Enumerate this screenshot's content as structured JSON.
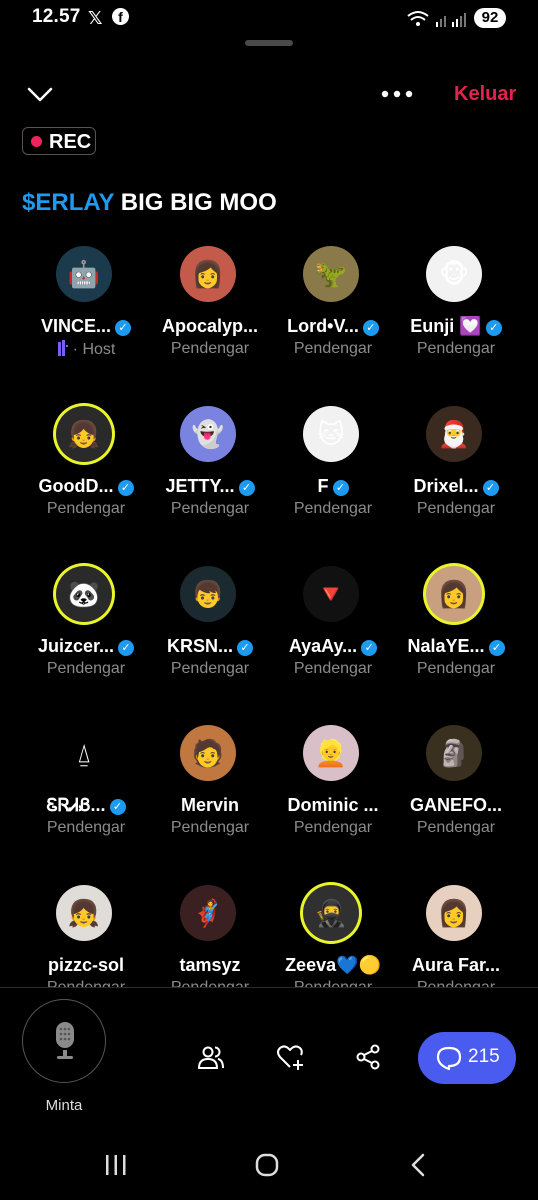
{
  "status_bar": {
    "time": "12.57",
    "battery": "92"
  },
  "header": {
    "leave_label": "Keluar",
    "rec_label": "REC"
  },
  "space": {
    "title_highlight": "$ERLAY",
    "title_rest": " BIG BIG MOO"
  },
  "participants": [
    {
      "name": "VINCE...",
      "verified": true,
      "role": "Host",
      "avatar_bg": "#1b3a4b",
      "glyph": "🤖"
    },
    {
      "name": "Apocalyp...",
      "verified": false,
      "role": "Pendengar",
      "avatar_bg": "#c45a4a",
      "glyph": "👩"
    },
    {
      "name": "Lord•V...",
      "verified": true,
      "role": "Pendengar",
      "avatar_bg": "#8a7a4a",
      "glyph": "🦖"
    },
    {
      "name": "Eunji 💟",
      "verified": true,
      "role": "Pendengar",
      "avatar_bg": "#f2f2f2",
      "glyph": "🐵"
    },
    {
      "name": "GoodD...",
      "verified": true,
      "role": "Pendengar",
      "avatar_bg": "#2a2a2a",
      "glyph": "👧",
      "ring": true
    },
    {
      "name": "JETTY...",
      "verified": true,
      "role": "Pendengar",
      "avatar_bg": "#7b83e0",
      "glyph": "👻"
    },
    {
      "name": "F",
      "verified": true,
      "role": "Pendengar",
      "avatar_bg": "#f1f1f1",
      "glyph": "🐱"
    },
    {
      "name": "Drixel...",
      "verified": true,
      "role": "Pendengar",
      "avatar_bg": "#3a2a20",
      "glyph": "🎅"
    },
    {
      "name": "Juizcer...",
      "verified": true,
      "role": "Pendengar",
      "avatar_bg": "#2a2a2a",
      "glyph": "🐼",
      "ring": true
    },
    {
      "name": "KRSN...",
      "verified": true,
      "role": "Pendengar",
      "avatar_bg": "#1a2a30",
      "glyph": "👦"
    },
    {
      "name": "AyaAy...",
      "verified": true,
      "role": "Pendengar",
      "avatar_bg": "#111111",
      "glyph": "🔻"
    },
    {
      "name": "NalaYE...",
      "verified": true,
      "role": "Pendengar",
      "avatar_bg": "#c8a080",
      "glyph": "👩",
      "ring": true
    },
    {
      "name": "ᏋᏒᏗᏰ...",
      "verified": true,
      "role": "Pendengar",
      "avatar_bg": "#000000",
      "glyph": "⍙"
    },
    {
      "name": "Mervin",
      "verified": false,
      "role": "Pendengar",
      "avatar_bg": "#c07840",
      "glyph": "🧑"
    },
    {
      "name": "Dominic ...",
      "verified": false,
      "role": "Pendengar",
      "avatar_bg": "#d9c0c8",
      "glyph": "👱"
    },
    {
      "name": "GANEFO...",
      "verified": false,
      "role": "Pendengar",
      "avatar_bg": "#3a3020",
      "glyph": "🗿"
    },
    {
      "name": "pizzc-sol",
      "verified": false,
      "role": "Pendengar",
      "avatar_bg": "#e0dcd8",
      "glyph": "👧"
    },
    {
      "name": "tamsyz",
      "verified": false,
      "role": "Pendengar",
      "avatar_bg": "#3a2020",
      "glyph": "🦸"
    },
    {
      "name": "Zeeva💙🟡",
      "verified": false,
      "role": "Pendengar",
      "avatar_bg": "#303030",
      "glyph": "🥷",
      "ring": true
    },
    {
      "name": "Aura Far...",
      "verified": false,
      "role": "Pendengar",
      "avatar_bg": "#e8d0c0",
      "glyph": "👩"
    }
  ],
  "bottom": {
    "mic_label": "Minta",
    "comment_count": "215"
  },
  "colors": {
    "accent": "#1d9bf0",
    "leave": "#e0244b",
    "chat_button": "#4a5bf0",
    "host_purple": "#7b5cf5"
  }
}
